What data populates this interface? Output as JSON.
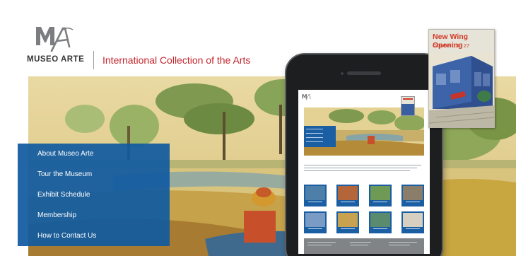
{
  "brand": {
    "name": "MUSEO ARTE",
    "logo_letters": "MA"
  },
  "site_title": "International Collection of the Arts",
  "nav": {
    "items": [
      {
        "label": "About Museo Arte"
      },
      {
        "label": "Tour the Museum"
      },
      {
        "label": "Exhibit Schedule"
      },
      {
        "label": "Membership"
      },
      {
        "label": "How to Contact Us"
      }
    ]
  },
  "poster": {
    "title": "New Wing Opening",
    "dates": "October 13 - 27"
  },
  "colors": {
    "accent_red": "#c4262e",
    "nav_blue": "#115aa0",
    "poster_red": "#d13a28"
  },
  "icons": {
    "logo": "museo-arte-logo-mark"
  }
}
